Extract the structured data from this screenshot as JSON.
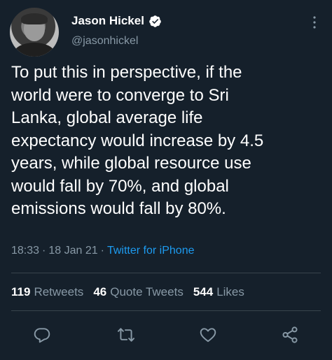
{
  "author": {
    "name": "Jason Hickel",
    "handle": "@jasonhickel"
  },
  "tweet": {
    "text": "To put this in perspective, if the\nworld were to converge to Sri\nLanka, global average life\nexpectancy would increase by 4.5\nyears, while global resource use\nwould fall by 70%, and global\nemissions would fall by 80%.",
    "time": "18:33",
    "separator1": "·",
    "date": "18 Jan 21",
    "separator2": "·",
    "source": "Twitter for iPhone"
  },
  "stats": {
    "retweets": {
      "count": "119",
      "label": "Retweets"
    },
    "quotes": {
      "count": "46",
      "label": "Quote Tweets"
    },
    "likes": {
      "count": "544",
      "label": "Likes"
    }
  },
  "icons": {
    "verified": "verified-badge-icon",
    "more": "more-options-icon",
    "reply": "reply-icon",
    "retweet": "retweet-icon",
    "like": "like-icon",
    "share": "share-icon"
  },
  "colors": {
    "background": "#15202b",
    "text": "#ffffff",
    "secondary": "#8899a6",
    "accent": "#1d9bf0",
    "divider": "#38444d"
  }
}
